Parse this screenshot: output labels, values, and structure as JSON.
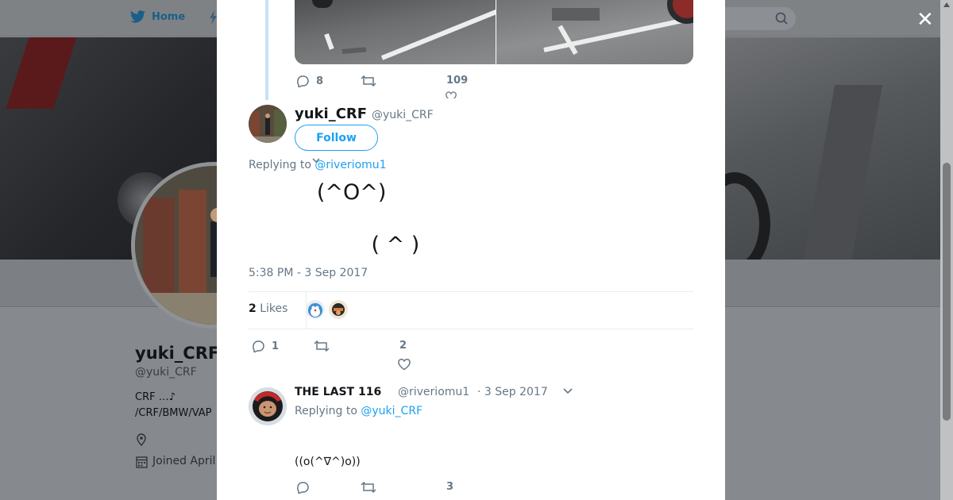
{
  "nav": {
    "home_label": "Home"
  },
  "profile": {
    "name": "yuki_CRF",
    "handle": "@yuki_CRF",
    "bio_line1": "CRF …♪",
    "bio_line2": "/CRF/BMW/VAP",
    "joined": "Joined April"
  },
  "prev_tweet": {
    "replies": "8",
    "likes": "109"
  },
  "tweet": {
    "author_name": "yuki_CRF",
    "author_handle": "@yuki_CRF",
    "follow_label": "Follow",
    "replying_prefix": "Replying to",
    "replying_to": "@riveriomu1",
    "text_line1": "          (^O^) ",
    "text_line2": "             ",
    "text_line3": "                  ( ^ ) ",
    "timestamp": "5:38 PM - 3 Sep 2017",
    "likes_count": "2",
    "likes_label": "Likes",
    "replies": "1",
    "likes": "2"
  },
  "reply": {
    "name": "THE LAST 116",
    "handle": "@riveriomu1",
    "date": "· 3 Sep 2017",
    "replying_prefix": "Replying to",
    "replying_to": "@yuki_CRF",
    "text": "((o(^∇^)o))",
    "likes": "3"
  },
  "colors": {
    "accent": "#1da1f2",
    "muted": "#657786",
    "overlay": "#8a8d91"
  }
}
